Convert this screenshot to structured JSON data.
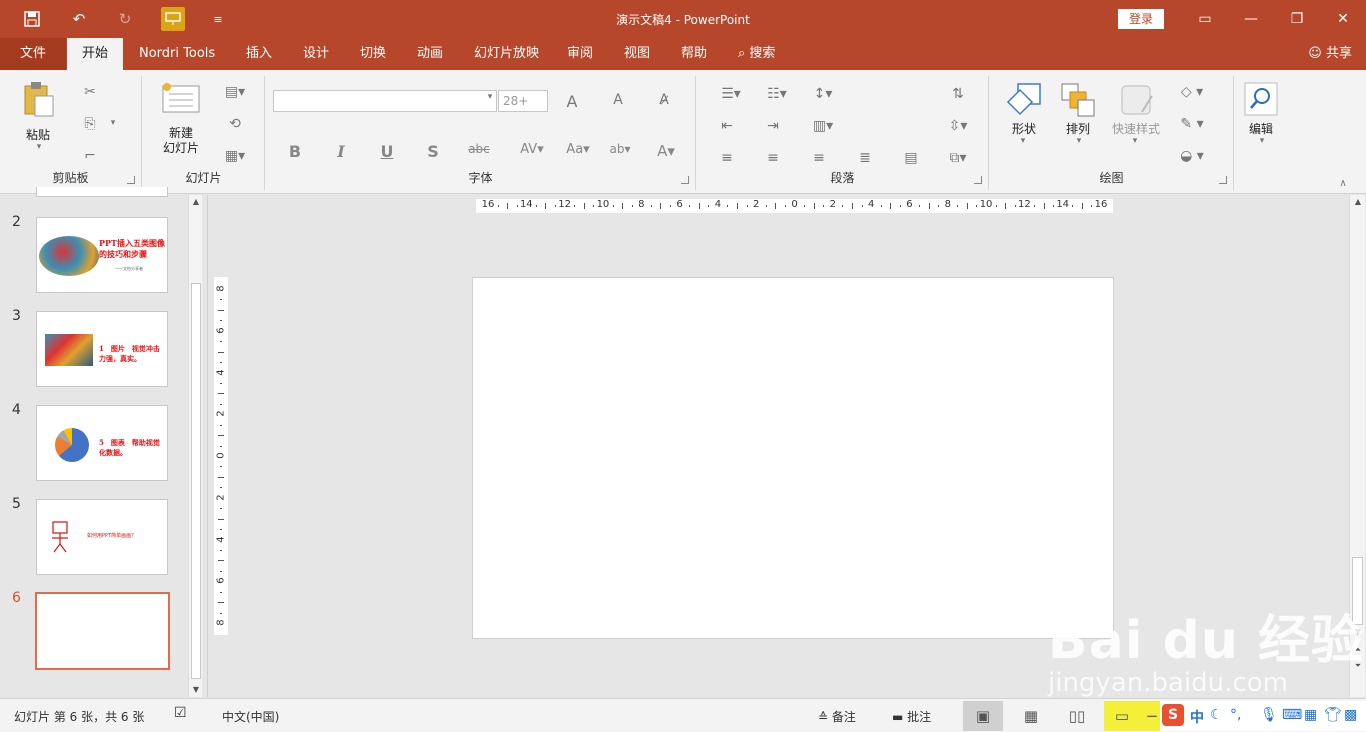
{
  "app": {
    "title": "演示文稿4  -  PowerPoint"
  },
  "titlebar": {
    "qat": {
      "save_icon": "save-icon",
      "undo_icon": "undo-icon",
      "redo_icon": "redo-icon",
      "present_icon": "present-from-start-icon",
      "customize_icon": "customize-qat-icon"
    },
    "login_label": "登录",
    "window_controls": [
      "ribbon-display-icon",
      "minimize-icon",
      "restore-icon",
      "close-icon"
    ]
  },
  "tabs": [
    {
      "label": "文件"
    },
    {
      "label": "开始"
    },
    {
      "label": "Nordri Tools"
    },
    {
      "label": "插入"
    },
    {
      "label": "设计"
    },
    {
      "label": "切换"
    },
    {
      "label": "动画"
    },
    {
      "label": "幻灯片放映"
    },
    {
      "label": "审阅"
    },
    {
      "label": "视图"
    },
    {
      "label": "帮助"
    },
    {
      "label": "搜索"
    }
  ],
  "share_label": "共享",
  "ribbon": {
    "clipboard": {
      "label": "剪贴板",
      "paste_label": "粘贴"
    },
    "slides": {
      "label": "幻灯片",
      "new_slide_label": "新建\n幻灯片"
    },
    "font": {
      "label": "字体",
      "font_name": "",
      "font_size": "28+"
    },
    "paragraph": {
      "label": "段落"
    },
    "drawing": {
      "label": "绘图",
      "shapes_label": "形状",
      "arrange_label": "排列",
      "quick_styles_label": "快速样式"
    },
    "editing": {
      "label": "编辑"
    }
  },
  "thumbnails": [
    {
      "num": "2",
      "text": "PPT插入五类图像的技巧和步骤",
      "sub": "一一文档分享者"
    },
    {
      "num": "3",
      "text": "1　图片　视觉冲击力强，真实。"
    },
    {
      "num": "4",
      "text": "5　图表　帮助视觉化数据。"
    },
    {
      "num": "5",
      "text": "如何用PPT简单画画？"
    },
    {
      "num": "6",
      "text": ""
    }
  ],
  "rulers": {
    "horizontal": [
      "16",
      "14",
      "12",
      "10",
      "8",
      "6",
      "4",
      "2",
      "0",
      "2",
      "4",
      "6",
      "8",
      "10",
      "12",
      "14",
      "16"
    ],
    "vertical": [
      "8",
      "6",
      "4",
      "2",
      "0",
      "2",
      "4",
      "6",
      "8"
    ]
  },
  "statusbar": {
    "slide_info": "幻灯片 第 6 张，共 6 张",
    "language": "中文(中国)",
    "notes_label": "备注",
    "comments_label": "批注"
  },
  "watermark": {
    "main": "Bai du 经验",
    "sub": "jingyan.baidu.com"
  },
  "colors": {
    "accent": "#b7472a",
    "qat_highlight": "#d9a416",
    "active_slide": "#e46b4a"
  }
}
